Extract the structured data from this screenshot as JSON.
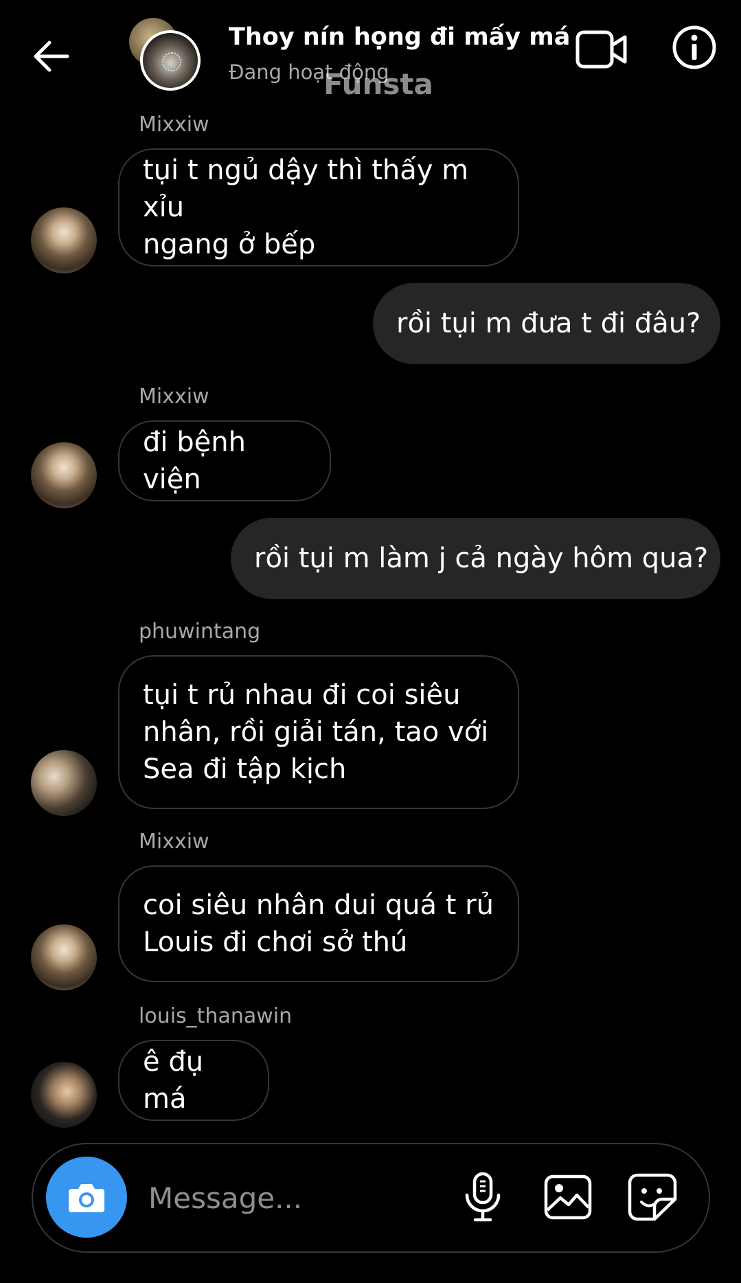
{
  "header": {
    "title": "Thoy nín họng đi mấy má",
    "status": "Đang hoạt động",
    "watermark": "Funsta"
  },
  "messages": [
    {
      "sender": "Mixxiw",
      "lines": [
        "tụi t ngủ dậy thì thấy m xỉu",
        "ngang ở bếp"
      ]
    },
    {
      "outgoing": "rồi tụi m đưa t đi đâu?"
    },
    {
      "sender": "Mixxiw",
      "lines": [
        "đi bệnh viện"
      ]
    },
    {
      "outgoing": "rồi tụi m làm j cả ngày hôm qua?"
    },
    {
      "sender": "phuwintang",
      "lines": [
        "tụi t rủ nhau đi coi siêu",
        "nhân, rồi giải tán, tao với",
        "Sea đi tập kịch"
      ]
    },
    {
      "sender": "Mixxiw",
      "lines": [
        "coi siêu nhân dui quá t rủ",
        "Louis đi chơi sở thú"
      ]
    },
    {
      "sender": "louis_thanawin",
      "lines": [
        "ê đụ má"
      ]
    }
  ],
  "composer": {
    "placeholder": "Message..."
  },
  "colors": {
    "background": "#000000",
    "outgoing_bubble": "#262626",
    "incoming_border": "#363636",
    "camera_button": "#3797f0",
    "secondary_text": "#a8a8a8"
  },
  "icons": [
    "back-arrow-icon",
    "video-call-icon",
    "info-icon",
    "camera-icon",
    "microphone-icon",
    "gallery-icon",
    "sticker-icon"
  ]
}
